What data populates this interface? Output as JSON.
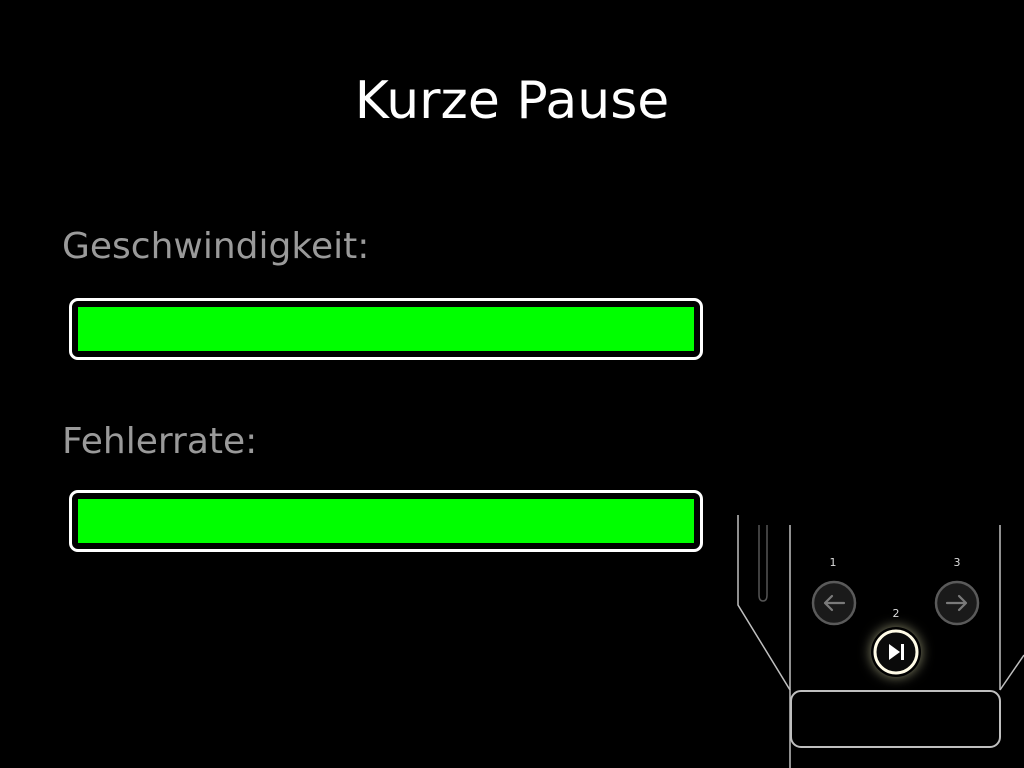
{
  "header": {
    "title": "Kurze Pause"
  },
  "metrics": [
    {
      "label": "Geschwindigkeit:",
      "level": 1.0
    },
    {
      "label": "Fehlerrate:",
      "level": 1.0
    }
  ],
  "colors": {
    "bar_fill": "#00ff00",
    "label": "#9a9a9a",
    "frame": "#ffffff",
    "background": "#000000"
  },
  "controller": {
    "buttons": [
      {
        "number": "1",
        "icon": "arrow-left-icon",
        "state": "inactive"
      },
      {
        "number": "2",
        "icon": "play-skip-icon",
        "state": "active"
      },
      {
        "number": "3",
        "icon": "arrow-right-icon",
        "state": "inactive"
      }
    ]
  }
}
